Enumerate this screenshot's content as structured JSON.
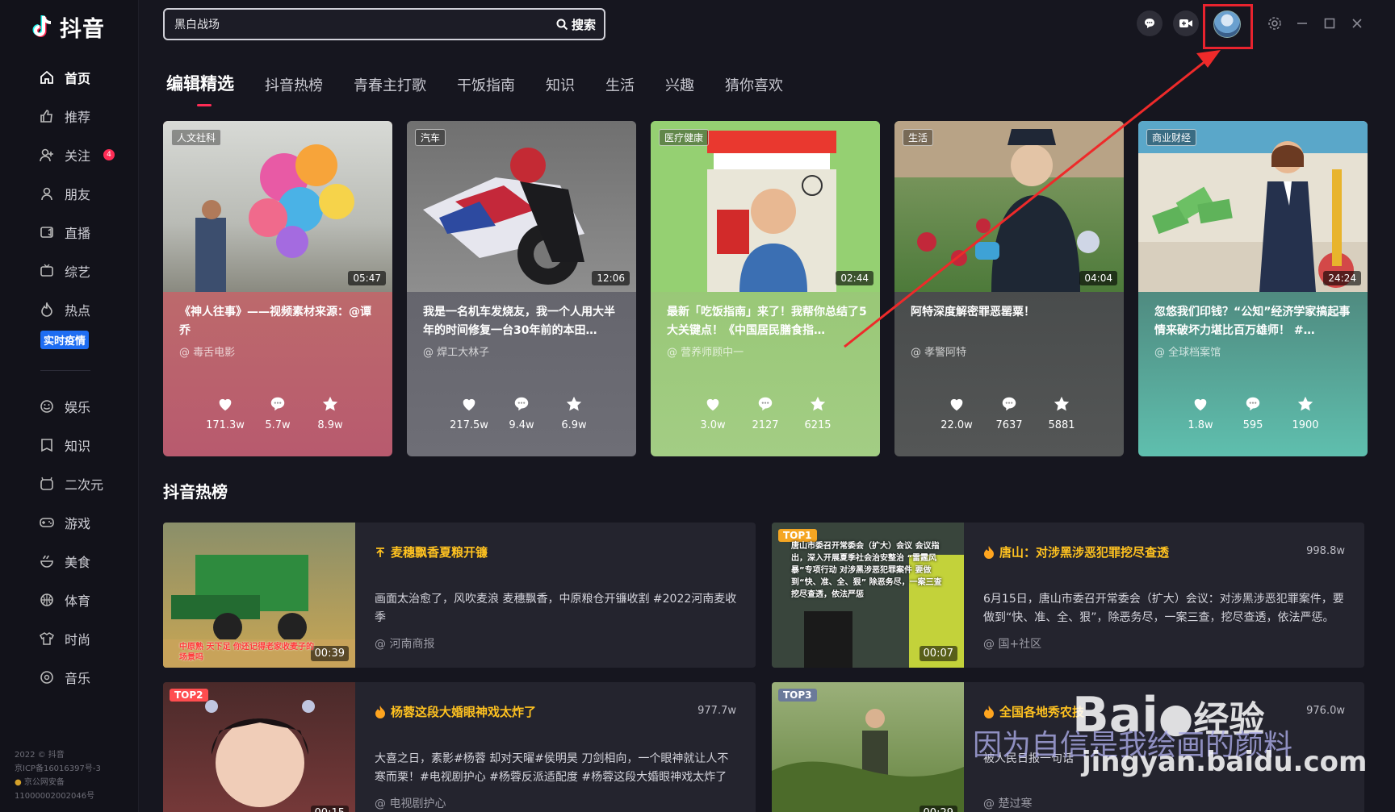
{
  "app": {
    "name": "抖音"
  },
  "search": {
    "value": "黑白战场",
    "button_label": "搜索"
  },
  "sidebar": {
    "items": [
      {
        "label": "首页",
        "icon": "home-icon",
        "active": true
      },
      {
        "label": "推荐",
        "icon": "thumbs-up-icon"
      },
      {
        "label": "关注",
        "icon": "user-plus-icon",
        "badge": "4"
      },
      {
        "label": "朋友",
        "icon": "friends-icon"
      },
      {
        "label": "直播",
        "icon": "live-icon"
      },
      {
        "label": "综艺",
        "icon": "tv-icon"
      },
      {
        "label": "热点",
        "icon": "flame-icon"
      }
    ],
    "covid_label": "实时疫情",
    "items2": [
      {
        "label": "娱乐",
        "icon": "smile-icon"
      },
      {
        "label": "知识",
        "icon": "book-icon"
      },
      {
        "label": "二次元",
        "icon": "anime-icon"
      },
      {
        "label": "游戏",
        "icon": "gamepad-icon"
      },
      {
        "label": "美食",
        "icon": "food-icon"
      },
      {
        "label": "体育",
        "icon": "ball-icon"
      },
      {
        "label": "时尚",
        "icon": "shirt-icon"
      },
      {
        "label": "音乐",
        "icon": "music-icon"
      }
    ],
    "footer": [
      "2022 © 抖音",
      "京ICP备16016397号-3",
      "京公网安备",
      "11000002002046号"
    ]
  },
  "tabs": [
    "编辑精选",
    "抖音热榜",
    "青春主打歌",
    "干饭指南",
    "知识",
    "生活",
    "兴趣",
    "猜你喜欢"
  ],
  "cards": [
    {
      "category": "人文社科",
      "duration": "05:47",
      "title": "《神人往事》——视频素材来源：@谭乔",
      "author": "@ 毒舌电影",
      "likes": "171.3w",
      "comments": "5.7w",
      "favorites": "8.9w",
      "color": "#b85a6e"
    },
    {
      "category": "汽车",
      "duration": "12:06",
      "title": "我是一名机车发烧友，我一个人用大半年的时间修复一台30年前的本田…",
      "author": "@ 焊工大林子",
      "likes": "217.5w",
      "comments": "9.4w",
      "favorites": "6.9w",
      "color": "#66666e"
    },
    {
      "category": "医疗健康",
      "duration": "02:44",
      "title": "最新「吃饭指南」来了！我帮你总结了5大关键点！《中国居民膳食指…",
      "author": "@ 营养师顾中一",
      "likes": "3.0w",
      "comments": "2127",
      "favorites": "6215",
      "color": "#8fc26a"
    },
    {
      "category": "生活",
      "duration": "04:04",
      "title": "阿特深度解密罪恶罂粟！",
      "author": "@ 孝警阿特",
      "likes": "22.0w",
      "comments": "7637",
      "favorites": "5881",
      "color": "#4f5252"
    },
    {
      "category": "商业财经",
      "duration": "24:24",
      "title": "忽悠我们印钱？“公知”经济学家搞起事情来破坏力堪比百万雄师！ #…",
      "author": "@ 全球档案馆",
      "likes": "1.8w",
      "comments": "595",
      "favorites": "1900",
      "color": "#4fb3a3"
    }
  ],
  "hot_section_title": "抖音热榜",
  "hot": [
    {
      "rank": "",
      "title": "麦穗飘香夏粮开镰",
      "count": "",
      "desc": "画面太治愈了，风吹麦浪 麦穗飘香，中原粮仓开镰收割 #2022河南麦收季",
      "author": "@ 河南商报",
      "duration": "00:39",
      "overlay": "中原熟 天下足 你还记得老家收麦子的场景吗",
      "icon": "arrow-up-icon"
    },
    {
      "rank": "TOP1",
      "title": "唐山：对涉黑涉恶犯罪挖尽查透",
      "count": "998.8w",
      "desc": "6月15日，唐山市委召开常委会（扩大）会议：对涉黑涉恶犯罪案件，要做到“快、准、全、狠”，除恶务尽，一案三查，挖尽查透，依法严惩。",
      "author": "@ 国+社区",
      "duration": "00:07",
      "overlay": "唐山市委召开常委会（扩大）会议 会议指出，深入开展夏季社会治安整治 “雷霆风暴”专项行动 对涉黑涉恶犯罪案件 要做到“快、准、全、狠” 除恶务尽，一案三查 挖尽查透，依法严惩",
      "icon": "flame-icon"
    },
    {
      "rank": "TOP2",
      "title": "杨蓉这段大婚眼神戏太炸了",
      "count": "977.7w",
      "desc": "大喜之日，素影#杨蓉 却对天曜#侯明昊 刀剑相向，一个眼神就让人不寒而栗！#电视剧护心 #杨蓉反派适配度 #杨蓉这段大婚眼神戏太炸了",
      "author": "@ 电视剧护心",
      "duration": "00:15",
      "overlay": "",
      "icon": "flame-icon"
    },
    {
      "rank": "TOP3",
      "title": "全国各地秀农技",
      "count": "976.0w",
      "desc": "被人民日报一句话",
      "author": "@ 楚过寒",
      "duration": "00:29",
      "overlay": "",
      "icon": "flame-icon"
    }
  ],
  "watermark": {
    "logo": "Bai",
    "logo2": "经验",
    "url": "jingyan.baidu.com",
    "caption": "因为自信是我绘画的颜料"
  },
  "colors": {
    "accent": "#fe2c55",
    "hot_title": "#ffc220",
    "highlight_box": "#e8232e"
  }
}
